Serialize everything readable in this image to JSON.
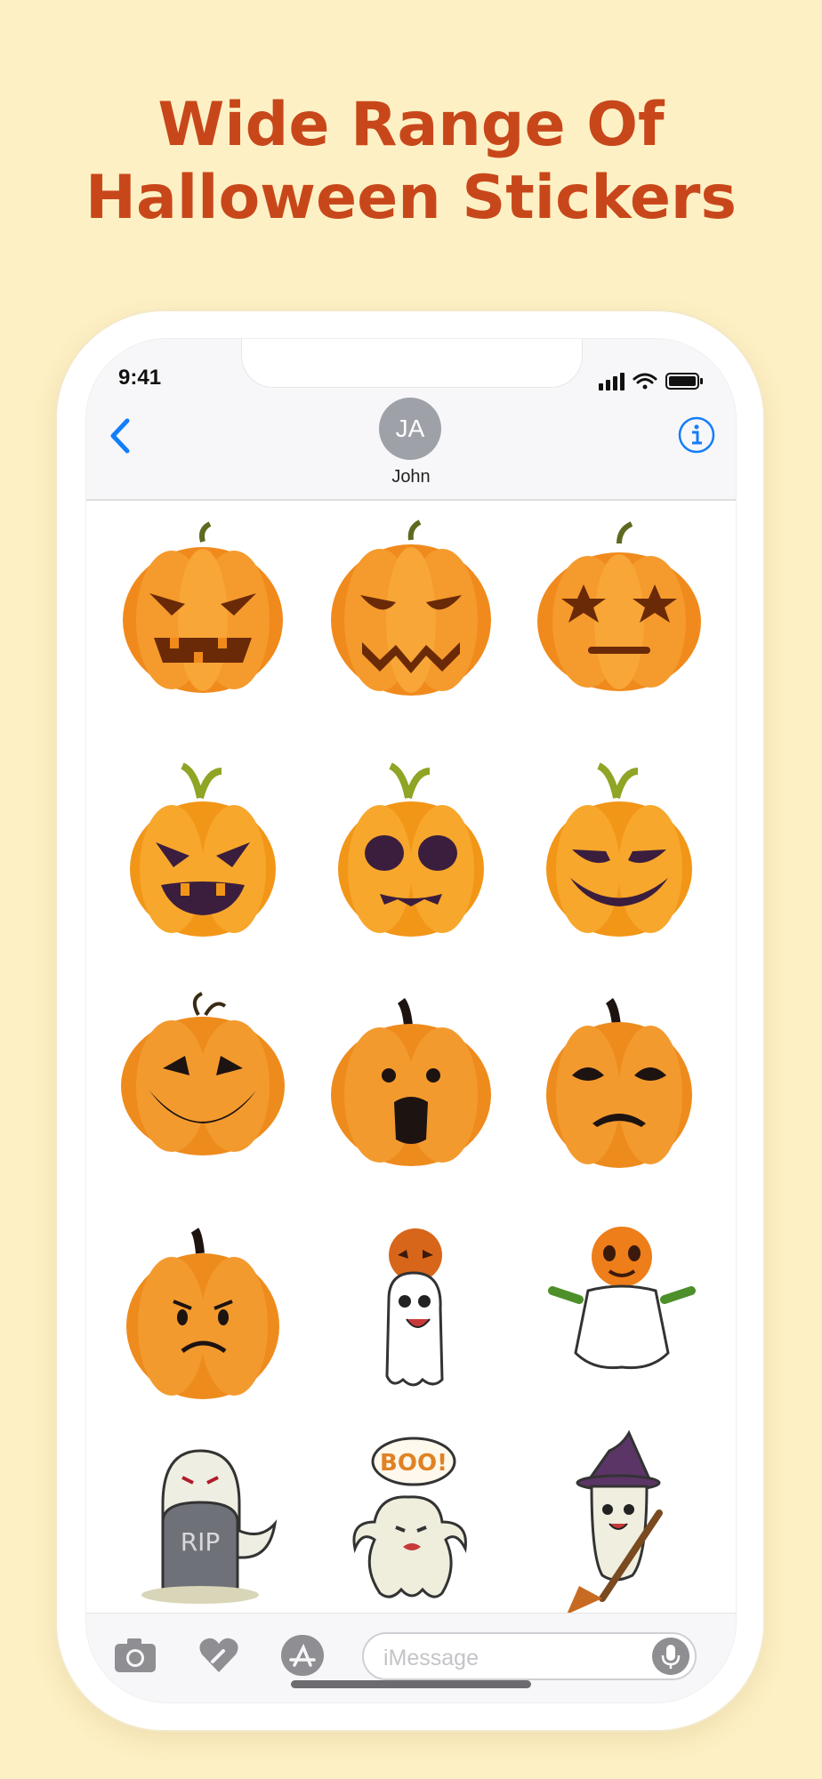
{
  "headline": {
    "line1": "Wide Range Of",
    "line2": "Halloween Stickers"
  },
  "status_bar": {
    "time": "9:41"
  },
  "header": {
    "avatar_initials": "JA",
    "contact_name": "John"
  },
  "stickers": [
    {
      "name": "pumpkin-angry-sticker"
    },
    {
      "name": "pumpkin-sad-zigzag-sticker"
    },
    {
      "name": "pumpkin-star-eyes-sticker"
    },
    {
      "name": "pumpkin-evil-grin-sticker"
    },
    {
      "name": "pumpkin-round-eyes-sticker"
    },
    {
      "name": "pumpkin-sly-grin-sticker"
    },
    {
      "name": "pumpkin-big-smile-sticker"
    },
    {
      "name": "pumpkin-surprised-sticker"
    },
    {
      "name": "pumpkin-frown-sticker"
    },
    {
      "name": "pumpkin-worried-sticker"
    },
    {
      "name": "ghost-holding-pumpkin-sticker"
    },
    {
      "name": "ghost-pumpkin-head-sticker"
    },
    {
      "name": "ghost-rip-tombstone-sticker"
    },
    {
      "name": "ghost-boo-sticker"
    },
    {
      "name": "ghost-witch-broom-sticker"
    }
  ],
  "boo_text": "BOO!",
  "rip_text": "RIP",
  "input": {
    "placeholder": "iMessage"
  },
  "colors": {
    "accent": "#147efb",
    "headline": "#c8471a",
    "background": "#fdf0c4",
    "pumpkin": "#f08a1c"
  }
}
